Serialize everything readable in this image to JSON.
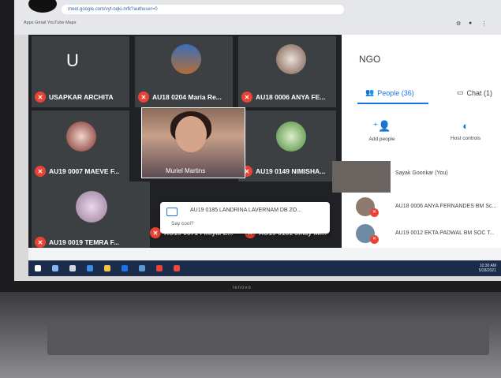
{
  "browser": {
    "url": "meet.google.com/vyt-oqki-mfk?authuser=0",
    "bookmarks": "Apps  Gmail  YouTube  Maps"
  },
  "meet": {
    "tiles": [
      {
        "name": "USAPKAR ARCHITA",
        "avatar_letter": "U"
      },
      {
        "name": "AU18 0204 Maria Re..."
      },
      {
        "name": "AU18 0006 ANYA FE..."
      },
      {
        "name": "AU19 0007 MAEVE F..."
      },
      {
        "name": "AU19 0149 NIMISHA..."
      },
      {
        "name": "AU19 0019 TEMRA F..."
      },
      {
        "name": "AU19 0071 Finiyal E..."
      },
      {
        "name": "AU19 0161 Jinay Mi..."
      }
    ],
    "spotlight_name": "Muriel Martins",
    "toast": {
      "message": "AU19 0185 LANDRINA LAVERNAM DB ZO...",
      "sub": "Say cool?"
    }
  },
  "panel": {
    "title": "NGO",
    "tabs": [
      {
        "label": "People (36)",
        "icon": "people-icon"
      },
      {
        "label": "Chat (1)",
        "icon": "chat-icon"
      }
    ],
    "actions": [
      {
        "label": "Add people",
        "icon": "add-person-icon"
      },
      {
        "label": "Host controls",
        "icon": "toggle-icon"
      }
    ],
    "people": [
      {
        "name": "Sayak Goonkar (You)"
      },
      {
        "name": "AU18 0006 ANYA FERNANDES BM Sc..."
      },
      {
        "name": "AU19 0012 EKTA PADWAL BM SOC T..."
      }
    ]
  },
  "taskbar": {
    "time": "10:30 AM",
    "date": "5/28/2021"
  },
  "laptop_brand": "lenovo",
  "colors": {
    "meet_bg": "#202124",
    "mic_off": "#ea4335",
    "accent": "#1a73e8",
    "taskbar": "#1b2b4a"
  }
}
